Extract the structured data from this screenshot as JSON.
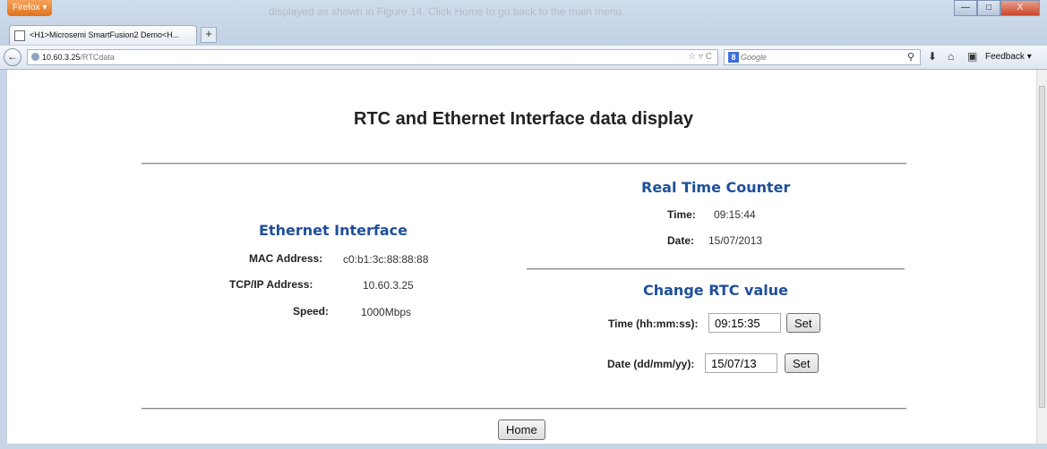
{
  "browser": {
    "app_button": "Firefox ▾",
    "bg_text": "displayed as shown in Figure 14. Click Home to go back to the main menu.",
    "tab_title": "<H1>Microsemi SmartFusion2 Demo<H...",
    "new_tab": "+",
    "url_host": "10.60.3.25",
    "url_path": "/RTCdata",
    "url_icons": "☆ ▿ C",
    "search_engine": "8",
    "search_placeholder": "Google",
    "feedback_label": "Feedback",
    "min_label": "—",
    "max_label": "□",
    "close_label": "X"
  },
  "page": {
    "title": "RTC and Ethernet Interface data display",
    "ethernet": {
      "heading": "Ethernet Interface",
      "mac_label": "MAC Address:",
      "mac_value": "c0:b1:3c:88:88:88",
      "ip_label": "TCP/IP Address:",
      "ip_value": "10.60.3.25",
      "speed_label": "Speed:",
      "speed_value": "1000Mbps"
    },
    "rtc": {
      "heading": "Real Time Counter",
      "time_label": "Time:",
      "time_value": "09:15:44",
      "date_label": "Date:",
      "date_value": "15/07/2013"
    },
    "change": {
      "heading": "Change RTC value",
      "time_label": "Time (hh:mm:ss):",
      "time_input": "09:15:35",
      "time_set": "Set",
      "date_label": "Date (dd/mm/yy):",
      "date_input": "15/07/13",
      "date_set": "Set"
    },
    "home_button": "Home"
  },
  "colors": {
    "heading": "#1f4f9a",
    "chrome": "#c8d5e6"
  }
}
